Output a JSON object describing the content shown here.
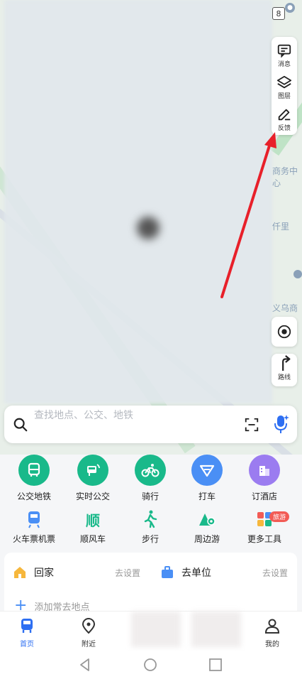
{
  "map": {
    "status_badge": "8",
    "edge_text_1": "商务中心",
    "edge_text_2": "仟里",
    "edge_text_3": "义乌商"
  },
  "toolbar": {
    "messages_label": "消息",
    "layers_label": "图层",
    "feedback_label": "反馈",
    "route_label": "路线"
  },
  "search": {
    "placeholder": "查找地点、公交、地铁"
  },
  "quick_actions": [
    {
      "label": "公交地铁",
      "color": "#19b98a"
    },
    {
      "label": "实时公交",
      "color": "#19b98a"
    },
    {
      "label": "骑行",
      "color": "#19b98a"
    },
    {
      "label": "打车",
      "color": "#4a8ff5"
    },
    {
      "label": "订酒店",
      "color": "#9b7cf0"
    }
  ],
  "secondary_actions": [
    {
      "label": "火车票机票"
    },
    {
      "label": "顺风车",
      "icon_text": "顺"
    },
    {
      "label": "步行"
    },
    {
      "label": "周边游"
    },
    {
      "label": "更多工具",
      "badge": "旅游"
    }
  ],
  "places": {
    "home_label": "回家",
    "home_action": "去设置",
    "work_label": "去单位",
    "work_action": "去设置",
    "add_label": "添加常去地点"
  },
  "nav": {
    "home": "首页",
    "nearby": "附近",
    "mine": "我的"
  },
  "colors": {
    "accent": "#2e6ff2",
    "green": "#19b98a",
    "annotation": "#e8202a"
  }
}
